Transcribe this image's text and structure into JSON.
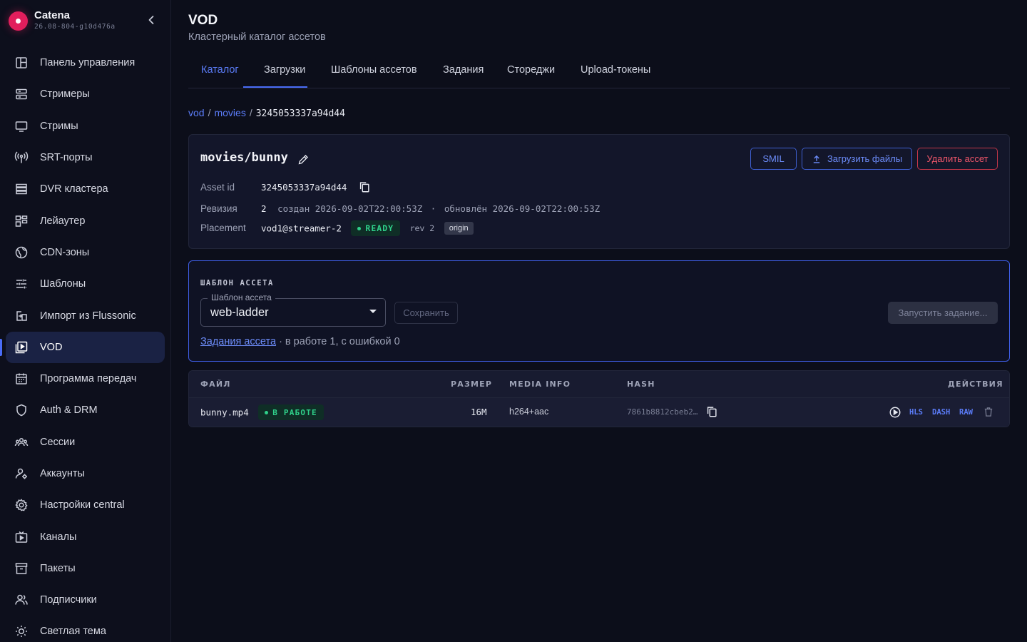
{
  "brand": {
    "name": "Catena",
    "version": "26.08-804-g10d476a"
  },
  "sidebar": {
    "items": [
      {
        "label": "Панель управления",
        "icon": "dashboard-icon"
      },
      {
        "label": "Стримеры",
        "icon": "server-icon"
      },
      {
        "label": "Стримы",
        "icon": "monitor-icon"
      },
      {
        "label": "SRT-порты",
        "icon": "antenna-icon"
      },
      {
        "label": "DVR кластера",
        "icon": "storage-icon"
      },
      {
        "label": "Лейаутер",
        "icon": "layout-icon"
      },
      {
        "label": "CDN-зоны",
        "icon": "globe-icon"
      },
      {
        "label": "Шаблоны",
        "icon": "sliders-icon"
      },
      {
        "label": "Импорт из Flussonic",
        "icon": "import-icon"
      },
      {
        "label": "VOD",
        "icon": "vod-icon",
        "active": true
      },
      {
        "label": "Программа передач",
        "icon": "calendar-icon"
      },
      {
        "label": "Auth & DRM",
        "icon": "shield-icon"
      },
      {
        "label": "Сессии",
        "icon": "sessions-icon"
      },
      {
        "label": "Аккаунты",
        "icon": "accounts-icon"
      },
      {
        "label": "Настройки central",
        "icon": "gear-icon"
      },
      {
        "label": "Каналы",
        "icon": "channels-icon"
      },
      {
        "label": "Пакеты",
        "icon": "archive-icon"
      },
      {
        "label": "Подписчики",
        "icon": "subscribers-icon"
      },
      {
        "label": "Светлая тема",
        "icon": "sun-icon"
      }
    ]
  },
  "header": {
    "title": "VOD",
    "subtitle": "Кластерный каталог ассетов"
  },
  "tabs": [
    {
      "label": "Каталог",
      "active": true
    },
    {
      "label": "Загрузки"
    },
    {
      "label": "Шаблоны ассетов"
    },
    {
      "label": "Задания"
    },
    {
      "label": "Стореджи"
    },
    {
      "label": "Upload-токены"
    }
  ],
  "breadcrumb": {
    "root": "vod",
    "folder": "movies",
    "current": "3245053337a94d44"
  },
  "asset": {
    "title": "movies/bunny",
    "buttons": {
      "smil": "SMIL",
      "upload": "Загрузить файлы",
      "delete": "Удалить ассет"
    },
    "asset_id_label": "Asset id",
    "asset_id": "3245053337a94d44",
    "revision_label": "Ревизия",
    "revision": "2",
    "created_label": "создан",
    "created": "2026-09-02T22:00:53Z",
    "updated_sep": "·",
    "updated_label": "обновлён",
    "updated": "2026-09-02T22:00:53Z",
    "placement_label": "Placement",
    "placement": "vod1@streamer-2",
    "placement_status": "READY",
    "placement_rev": "rev 2",
    "placement_role": "origin"
  },
  "template": {
    "section_title": "ШАБЛОН АССЕТА",
    "select_label": "Шаблон ассета",
    "select_value": "web-ladder",
    "save_label": "Сохранить",
    "run_label": "Запустить задание...",
    "jobs_link": "Задания ассета",
    "jobs_summary": "· в работе 1, с ошибкой 0"
  },
  "files": {
    "columns": {
      "file": "ФАЙЛ",
      "size": "РАЗМЕР",
      "media": "MEDIA INFO",
      "hash": "HASH",
      "actions": "ДЕЙСТВИЯ"
    },
    "rows": [
      {
        "name": "bunny.mp4",
        "status": "В РАБОТЕ",
        "size": "16M",
        "media": "h264+aac",
        "hash": "7861b8812cbeb2…",
        "actions": {
          "hls": "HLS",
          "dash": "DASH",
          "raw": "RAW"
        }
      }
    ]
  },
  "colors": {
    "accent": "#4a6cf7",
    "danger": "#f0566a",
    "success": "#2fd08a",
    "brand": "#e21e5c"
  }
}
